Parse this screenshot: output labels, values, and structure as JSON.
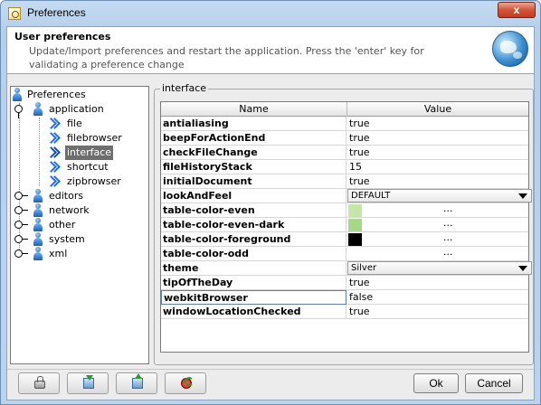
{
  "window": {
    "title": "Preferences",
    "close_label": "x"
  },
  "header": {
    "title": "User preferences",
    "description": "Update/Import preferences and restart the application. Press the 'enter' key for validating a preference change"
  },
  "tree": {
    "root": "Preferences",
    "nodes": [
      {
        "label": "application",
        "expanded": true,
        "children": [
          "file",
          "filebrowser",
          "interface",
          "shortcut",
          "zipbrowser"
        ]
      },
      {
        "label": "editors",
        "expanded": false
      },
      {
        "label": "network",
        "expanded": false
      },
      {
        "label": "other",
        "expanded": false
      },
      {
        "label": "system",
        "expanded": false
      },
      {
        "label": "xml",
        "expanded": false
      }
    ],
    "selected": "interface"
  },
  "panel": {
    "title": "interface",
    "columns": [
      "Name",
      "Value"
    ],
    "rows": [
      {
        "name": "antialiasing",
        "value": "true"
      },
      {
        "name": "beepForActionEnd",
        "value": "true"
      },
      {
        "name": "checkFileChange",
        "value": "true"
      },
      {
        "name": "fileHistoryStack",
        "value": "15"
      },
      {
        "name": "initialDocument",
        "value": "true"
      },
      {
        "name": "lookAndFeel",
        "value": "DEFAULT",
        "type": "combo"
      },
      {
        "name": "table-color-even",
        "value": "...",
        "type": "color",
        "color": "#c5e6a6"
      },
      {
        "name": "table-color-even-dark",
        "value": "...",
        "type": "color",
        "color": "#a7d888"
      },
      {
        "name": "table-color-foreground",
        "value": "...",
        "type": "color",
        "color": "#000000"
      },
      {
        "name": "table-color-odd",
        "value": "...",
        "type": "color",
        "color": "#ffffff"
      },
      {
        "name": "theme",
        "value": "Silver",
        "type": "combo"
      },
      {
        "name": "tipOfTheDay",
        "value": "true"
      },
      {
        "name": "webkitBrowser",
        "value": "false",
        "editing": true
      },
      {
        "name": "windowLocationChecked",
        "value": "true"
      }
    ]
  },
  "bottom": {
    "tools": [
      "lock-icon",
      "import-icon",
      "export-icon",
      "restore-defaults-icon"
    ],
    "ok_label": "Ok",
    "cancel_label": "Cancel"
  },
  "colors": {
    "title_gradient_top": "#c5dbf2",
    "close_red": "#d2553a",
    "selection_bg": "#6e6e6e"
  }
}
